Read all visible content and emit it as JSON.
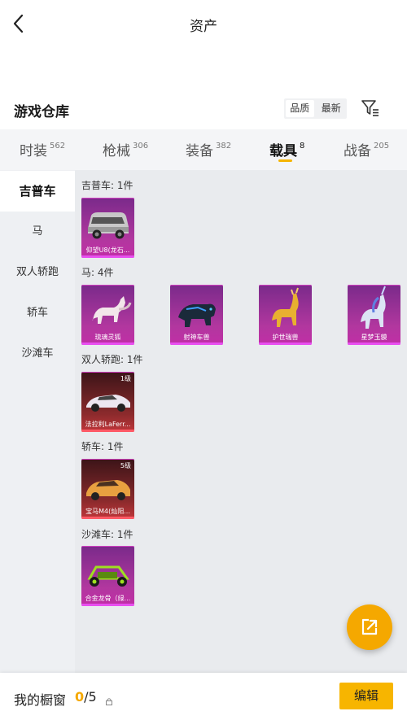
{
  "header": {
    "title": "资产"
  },
  "section": {
    "title": "游戏仓库"
  },
  "sort": {
    "quality": "品质",
    "newest": "最新"
  },
  "tabs": [
    {
      "label": "时装",
      "count": "562"
    },
    {
      "label": "枪械",
      "count": "306"
    },
    {
      "label": "装备",
      "count": "382"
    },
    {
      "label": "载具",
      "count": "8"
    },
    {
      "label": "战备",
      "count": "205"
    }
  ],
  "sidebar": [
    {
      "label": "吉普车"
    },
    {
      "label": "马"
    },
    {
      "label": "双人轿跑"
    },
    {
      "label": "轿车"
    },
    {
      "label": "沙滩车"
    }
  ],
  "groups": [
    {
      "title": "吉普车: 1件",
      "items": [
        {
          "name": "仰望U8(龙石..."
        }
      ]
    },
    {
      "title": "马: 4件",
      "items": [
        {
          "name": "琉璃灵狐"
        },
        {
          "name": "射神车兽"
        },
        {
          "name": "护世瑞兽"
        },
        {
          "name": "星梦玉貘"
        }
      ]
    },
    {
      "title": "双人轿跑: 1件",
      "items": [
        {
          "name": "法拉利LaFerr...",
          "level": "1级"
        }
      ]
    },
    {
      "title": "轿车: 1件",
      "items": [
        {
          "name": "宝马M4(灿阳...",
          "level": "5级"
        }
      ]
    },
    {
      "title": "沙滩车: 1件",
      "items": [
        {
          "name": "合金龙骨（绿..."
        }
      ]
    }
  ],
  "bottom": {
    "label": "我的橱窗",
    "current": "0",
    "total": "/5",
    "edit": "编辑"
  },
  "colors": {
    "accent": "#f5b400",
    "card_purple": "#b2379f",
    "card_red": "#8b2a2c"
  }
}
